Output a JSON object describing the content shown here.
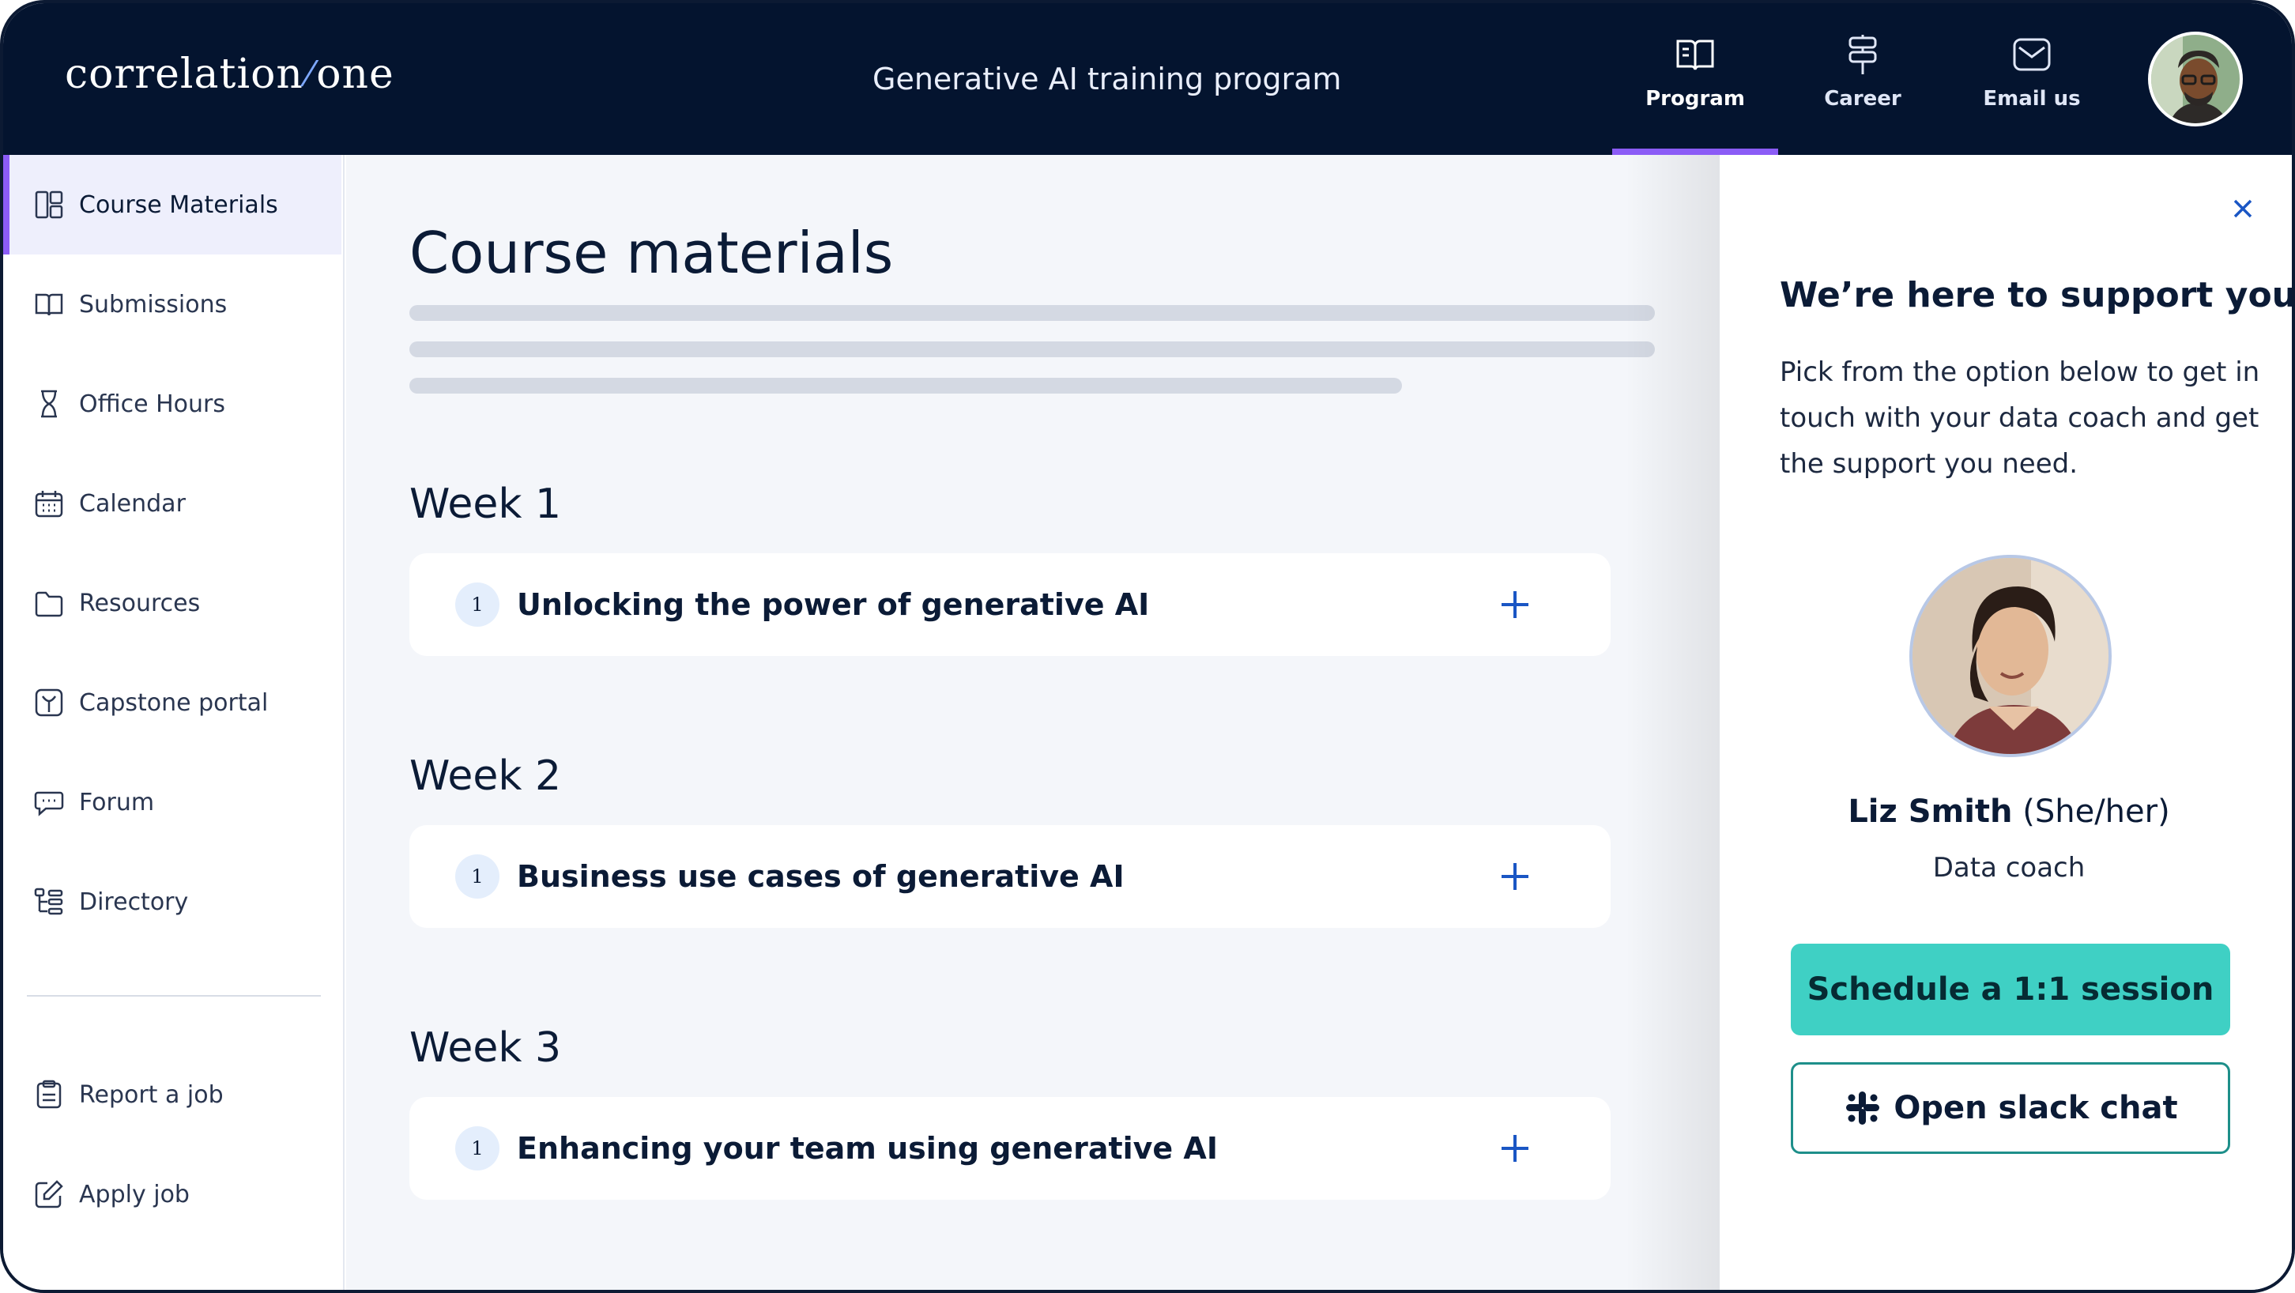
{
  "header": {
    "logo_left": "correlation",
    "logo_right": "one",
    "program_title": "Generative AI training program",
    "nav": [
      {
        "label": "Program",
        "icon": "book-open-icon",
        "active": true
      },
      {
        "label": "Career",
        "icon": "signpost-icon",
        "active": false
      },
      {
        "label": "Email us",
        "icon": "mail-icon",
        "active": false
      }
    ]
  },
  "sidebar": {
    "items": [
      {
        "label": "Course Materials",
        "icon": "layout-grid-icon",
        "active": true
      },
      {
        "label": "Submissions",
        "icon": "book-icon"
      },
      {
        "label": "Office Hours",
        "icon": "hourglass-icon"
      },
      {
        "label": "Calendar",
        "icon": "calendar-icon"
      },
      {
        "label": "Resources",
        "icon": "folder-icon"
      },
      {
        "label": "Capstone portal",
        "icon": "capstone-icon"
      },
      {
        "label": "Forum",
        "icon": "chat-icon"
      },
      {
        "label": "Directory",
        "icon": "directory-icon"
      }
    ],
    "bottom_items": [
      {
        "label": "Report a job",
        "icon": "report-icon"
      },
      {
        "label": "Apply job",
        "icon": "edit-icon"
      }
    ]
  },
  "main": {
    "title": "Course materials",
    "weeks": [
      {
        "label": "Week 1",
        "number": "1",
        "title": "Unlocking the power of generative AI"
      },
      {
        "label": "Week 2",
        "number": "1",
        "title": "Business use cases of generative AI"
      },
      {
        "label": "Week 3",
        "number": "1",
        "title": "Enhancing your team using generative AI"
      }
    ]
  },
  "support": {
    "title": "We’re here to support you",
    "text": "Pick from the option below to get in touch with your data coach and get the support you need.",
    "coach_name": "Liz Smith",
    "coach_pronouns": "(She/her)",
    "coach_role": "Data coach",
    "primary_button": "Schedule a 1:1 session",
    "secondary_button": "Open slack chat"
  },
  "colors": {
    "header_bg": "#04142f",
    "accent_purple": "#8b5cf6",
    "primary_teal": "#3fd0c4",
    "link_blue": "#1a56c4"
  }
}
